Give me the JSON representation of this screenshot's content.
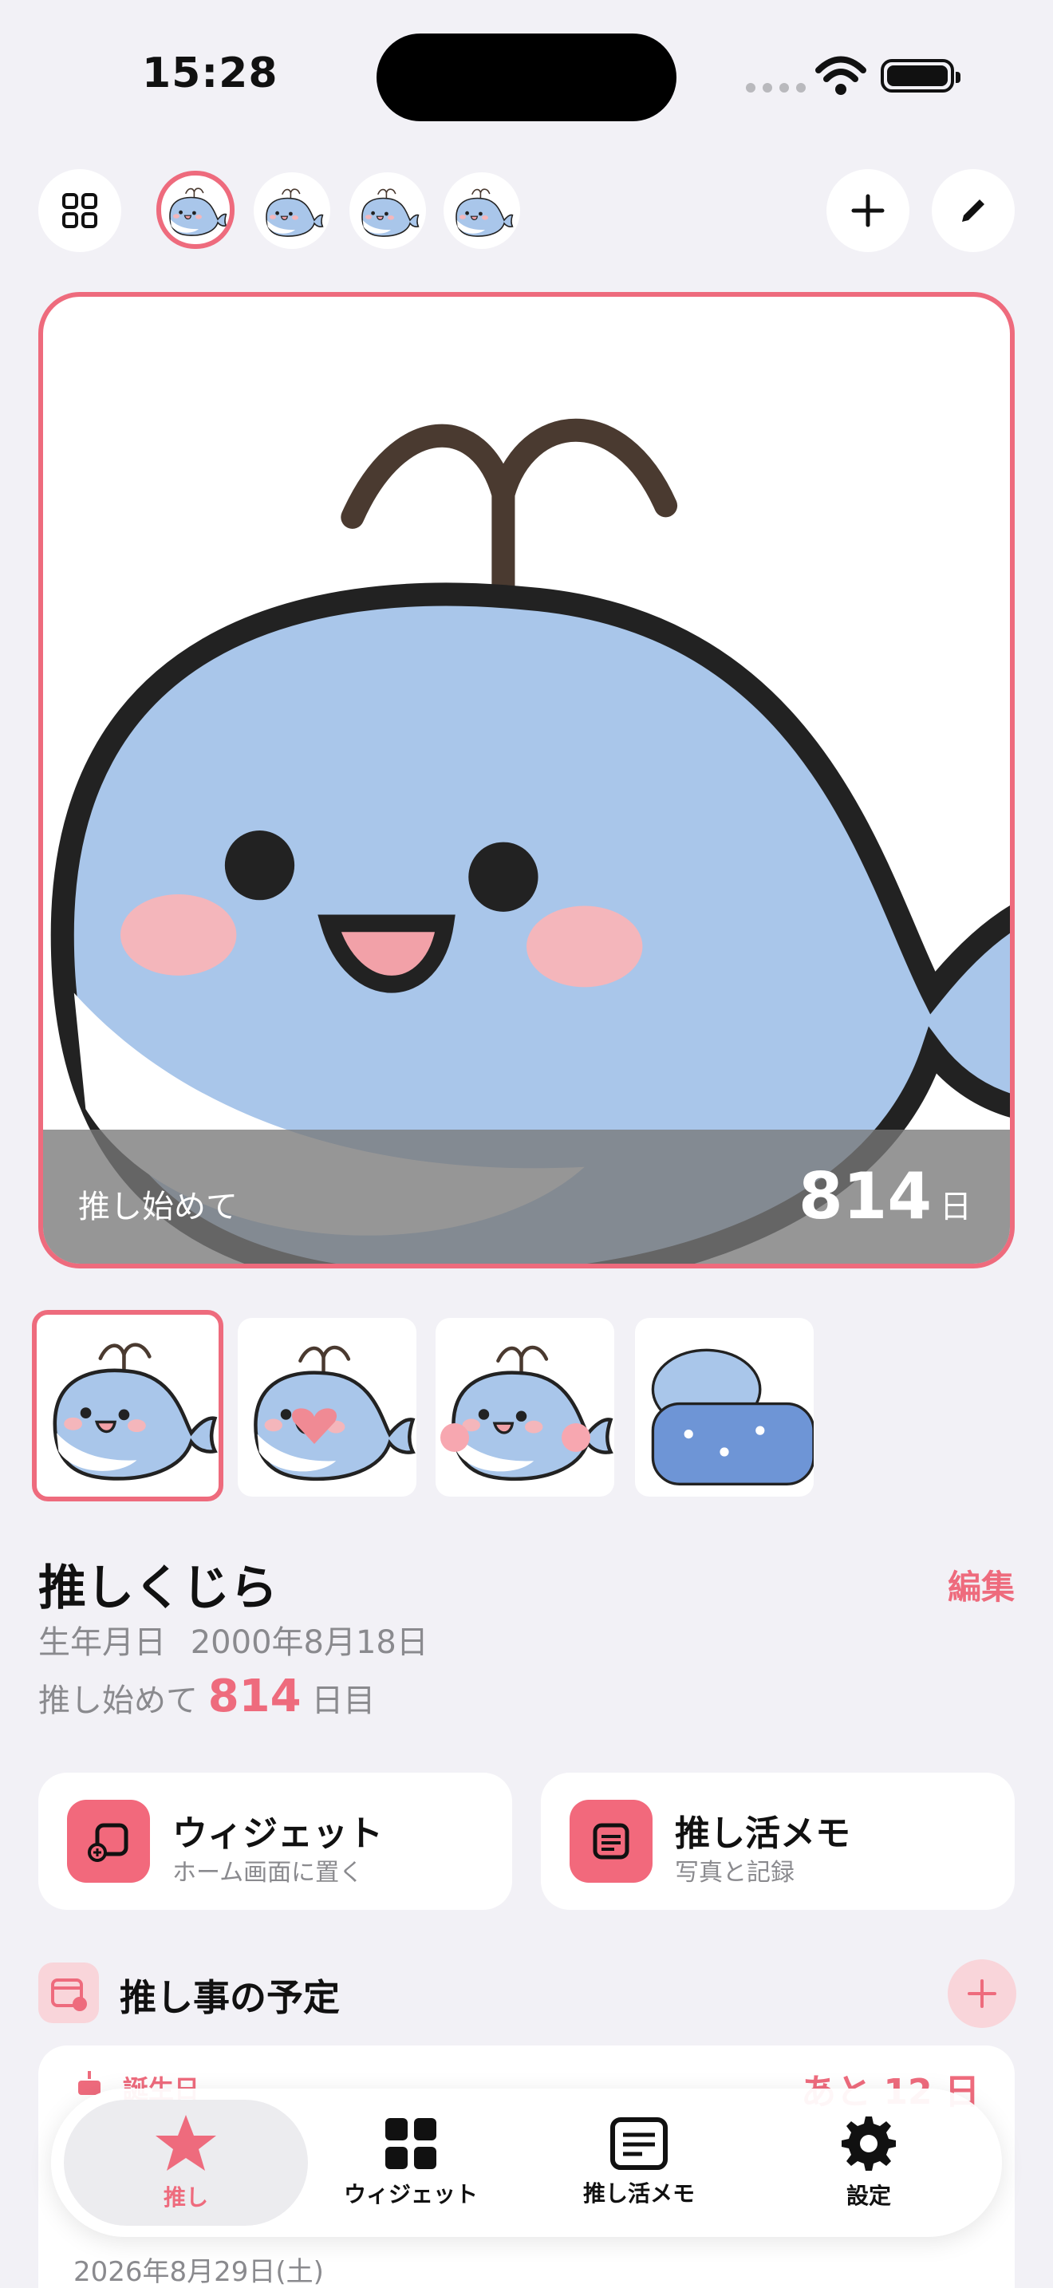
{
  "status_bar": {
    "time": "15:28"
  },
  "toolbar": {
    "grid_icon": "grid-icon",
    "add_icon": "plus-icon",
    "edit_icon": "pencil-icon"
  },
  "main_card": {
    "overlay_label": "推し始めて",
    "overlay_count": "814",
    "overlay_unit": "日"
  },
  "profile": {
    "name": "推しくじら",
    "edit_label": "編集",
    "birth_label": "生年月日",
    "birth_date": "2000年8月18日",
    "since_label": "推し始めて",
    "since_count": "814",
    "since_unit": "日目"
  },
  "features": [
    {
      "title": "ウィジェット",
      "subtitle": "ホーム画面に置く",
      "icon": "widget-add-icon"
    },
    {
      "title": "推し活メモ",
      "subtitle": "写真と記録",
      "icon": "memo-icon"
    }
  ],
  "schedule": {
    "title": "推し事の予定",
    "event": {
      "kind": "誕生日",
      "remaining": "あと 12 日",
      "date": "2026年8月29日(土)"
    }
  },
  "tabbar": {
    "tabs": [
      {
        "label": "推し",
        "icon": "star-icon",
        "active": true
      },
      {
        "label": "ウィジェット",
        "icon": "widgets-icon",
        "active": false
      },
      {
        "label": "推し活メモ",
        "icon": "memo-icon",
        "active": false
      },
      {
        "label": "設定",
        "icon": "gear-icon",
        "active": false
      }
    ]
  },
  "colors": {
    "accent": "#ee6b7d",
    "background": "#f2f1f6",
    "whale_blue": "#a9c6ea"
  }
}
